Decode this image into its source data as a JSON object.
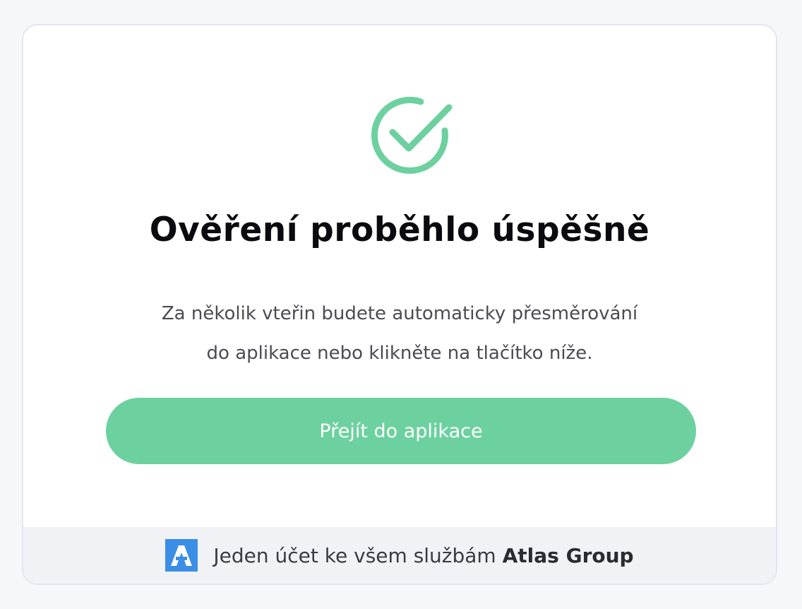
{
  "title": "Ověření proběhlo úspěšně",
  "description": {
    "line1": "Za několik vteřin budete automaticky přesměrování",
    "line2": "do aplikace nebo klikněte na tlačítko níže."
  },
  "button": {
    "label": "Přejít do aplikace"
  },
  "footer": {
    "text": "Jeden účet ke všem službám",
    "brand": "Atlas Group",
    "logo_icon": "atlas-logo-icon"
  },
  "icons": {
    "success": "check-circle-icon"
  },
  "colors": {
    "accent": "#6cd19f",
    "logo": "#3b8ee6",
    "title": "#0b0b0f",
    "text": "#4b4b52",
    "footer_bg": "#f1f2f6"
  }
}
